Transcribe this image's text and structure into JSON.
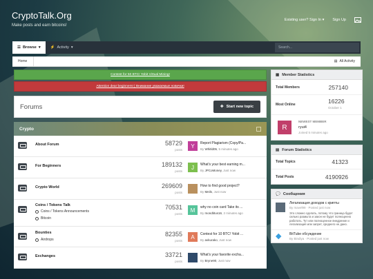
{
  "site": {
    "title": "CryptoTalk.Org",
    "subtitle": "Make posts and earn bitcoins!"
  },
  "top_links": {
    "signin": "Existing user? Sign In",
    "signup": "Sign Up"
  },
  "nav": {
    "tabs": [
      {
        "label": "Browse"
      },
      {
        "label": "Activity"
      }
    ],
    "search_placeholder": "Search..."
  },
  "breadcrumb": {
    "home": "Home",
    "all_activity": "All Activity"
  },
  "banners": {
    "green": "Contest for 50 BTC! Yobit Virtual Mining!",
    "red": "Attention dear beginners! | Внимание уважаемые новички!"
  },
  "forums": {
    "title": "Forums",
    "start_topic": "Start new topic"
  },
  "category": {
    "name": "Crypto"
  },
  "posts_label": "posts",
  "forum_rows": [
    {
      "name": "About Forum",
      "count": "58729",
      "avatar_letter": "Y",
      "avatar_color": "#c13f9a",
      "topic": "Report Plagiarism (Copy/Pa...",
      "by": "Whitld05",
      "time": "5 minutes ago"
    },
    {
      "name": "For Beginners",
      "count": "189132",
      "avatar_letter": "J",
      "avatar_color": "#7dbf4e",
      "topic": "What's your best earning m...",
      "by": "JPCoMoney",
      "time": "Just now"
    },
    {
      "name": "Crypto World",
      "count": "269609",
      "avatar_letter": "",
      "avatar_color": "#b9905e",
      "topic": "How to find good project?",
      "by": "Meils",
      "time": "Just now"
    },
    {
      "name": "Coins / Tokens Talk",
      "sub1": "Coins / Tokens Announcements",
      "sub2": "Bitcoin",
      "count": "70531",
      "avatar_letter": "M",
      "avatar_color": "#56c49a",
      "topic": "why no coin card Take its ...",
      "by": "mondtitus16",
      "time": "2 minutes ago"
    },
    {
      "name": "Bounties",
      "sub1": "Airdrops",
      "count": "82355",
      "avatar_letter": "A",
      "avatar_color": "#e07a5a",
      "topic": "Contest for 10 BTC! Yobit ...",
      "by": "avkurako",
      "time": "Just now"
    },
    {
      "name": "Exchanges",
      "count": "33721",
      "avatar_letter": "",
      "avatar_color": "#2f4a6a",
      "topic": "What's your favorite excha...",
      "by": "Bryne90",
      "time": "Just now"
    }
  ],
  "member_stats": {
    "title": "Member Statistics",
    "total_members_label": "Total Members",
    "total_members": "257140",
    "most_online_label": "Most Online",
    "most_online": "16226",
    "most_online_date": "October 1",
    "newest_label": "NEWEST MEMBER",
    "newest_name": "ryui4",
    "newest_time": "Joined 5 minutes ago",
    "newest_letter": "R",
    "newest_color": "#c13f6a"
  },
  "forum_stats": {
    "title": "Forum Statistics",
    "topics_label": "Total Topics",
    "topics": "41323",
    "posts_label": "Total Posts",
    "posts": "4190926"
  },
  "messages": {
    "title": "Сообщения",
    "items": [
      {
        "title": "Легализация доходов с крипты",
        "by": "By mavel99",
        "time": "Posted just now",
        "text": "Это сложно сделать, потому что граница будет сильно размыта и закон не будет полноценно работать. Тут или полноценное внедрение и легализация или запрет, среднего не дано."
      },
      {
        "title": "BitTube обсуждение",
        "by": "By Bindiya",
        "time": "Posted just now"
      }
    ]
  }
}
